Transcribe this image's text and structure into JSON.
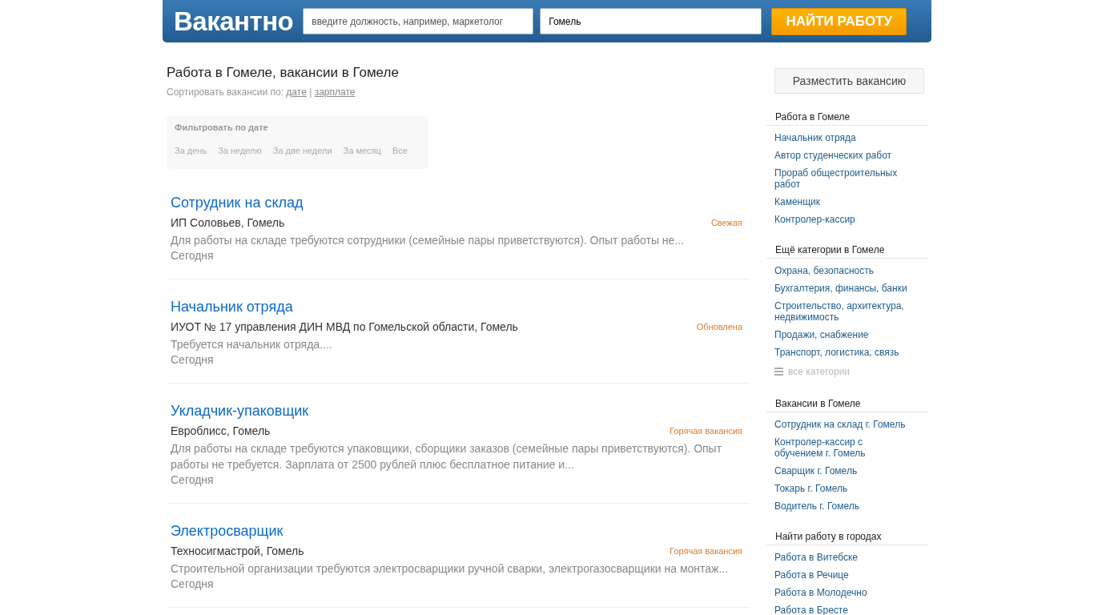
{
  "header": {
    "logo": "Вакантно",
    "search": {
      "placeholder": "введите должность, например, маркетолог"
    },
    "city": {
      "value": "Гомель"
    },
    "submit": "НАЙТИ РАБОТУ"
  },
  "page_title": "Работа в Гомеле, вакансии в Гомеле",
  "sort": {
    "label": "Сортировать вакансии по:",
    "options": [
      "дате",
      "зарплате"
    ],
    "separator": "|"
  },
  "date_filter": {
    "title": "Фильтровать по дате",
    "options": [
      "За день",
      "За неделю",
      "За две недели",
      "За месяц",
      "Все"
    ]
  },
  "vacancies": [
    {
      "title": "Сотрудник на склад",
      "company": "ИП Соловьев, Гомель",
      "tag": "Свежая",
      "description": "Для работы на складе требуются сотрудники (семейные пары приветствуются). Опыт работы не...",
      "date": "Сегодня"
    },
    {
      "title": "Начальник отряда",
      "company": "ИУОТ № 17 управления ДИН МВД по Гомельской области, Гомель",
      "tag": "Обновлена",
      "description": "Требуется начальник отряда....",
      "date": "Сегодня"
    },
    {
      "title": "Укладчик-упаковщик",
      "company": "Евроблисс, Гомель",
      "tag": "Горячая вакансия",
      "description": "Для работы на складе требуются упаковщики, сборщики заказов (семейные пары приветствуются). Опыт работы не требуется. Зарплата от 2500 рублей плюс бесплатное питание и...",
      "date": "Сегодня"
    },
    {
      "title": "Электросварщик",
      "company": "Техносигмастрой, Гомель",
      "tag": "Горячая вакансия",
      "description": "Строительной организации требуются электросварщики ручной сварки, электрогазосварщики на монтаж...",
      "date": "Сегодня"
    }
  ],
  "sidebar": {
    "post_button": "Разместить вакансию",
    "sections": [
      {
        "title": "Работа в Гомеле",
        "links": [
          "Начальник отряда",
          "Автор студенческих работ",
          "Прораб общестроительных работ",
          "Каменщик",
          "Контролер-кассир"
        ]
      },
      {
        "title": "Ещё категории в Гомеле",
        "links": [
          "Охрана, безопасность",
          "Бухгалтерия, финансы, банки",
          "Строительство, архитектура, недвижимость",
          "Продажи, снабжение",
          "Транспорт, логистика, связь"
        ],
        "more": "все категории"
      },
      {
        "title": "Вакансии в Гомеле",
        "links": [
          "Сотрудник на склад г. Гомель",
          "Контролер-кассир с обучением г. Гомель",
          "Сварщик г. Гомель",
          "Токарь г. Гомель",
          "Водитель г. Гомель"
        ]
      },
      {
        "title": "Найти работу в городах",
        "links": [
          "Работа в Витебске",
          "Работа в Речице",
          "Работа в Молодечно",
          "Работа в Бресте"
        ]
      }
    ]
  }
}
